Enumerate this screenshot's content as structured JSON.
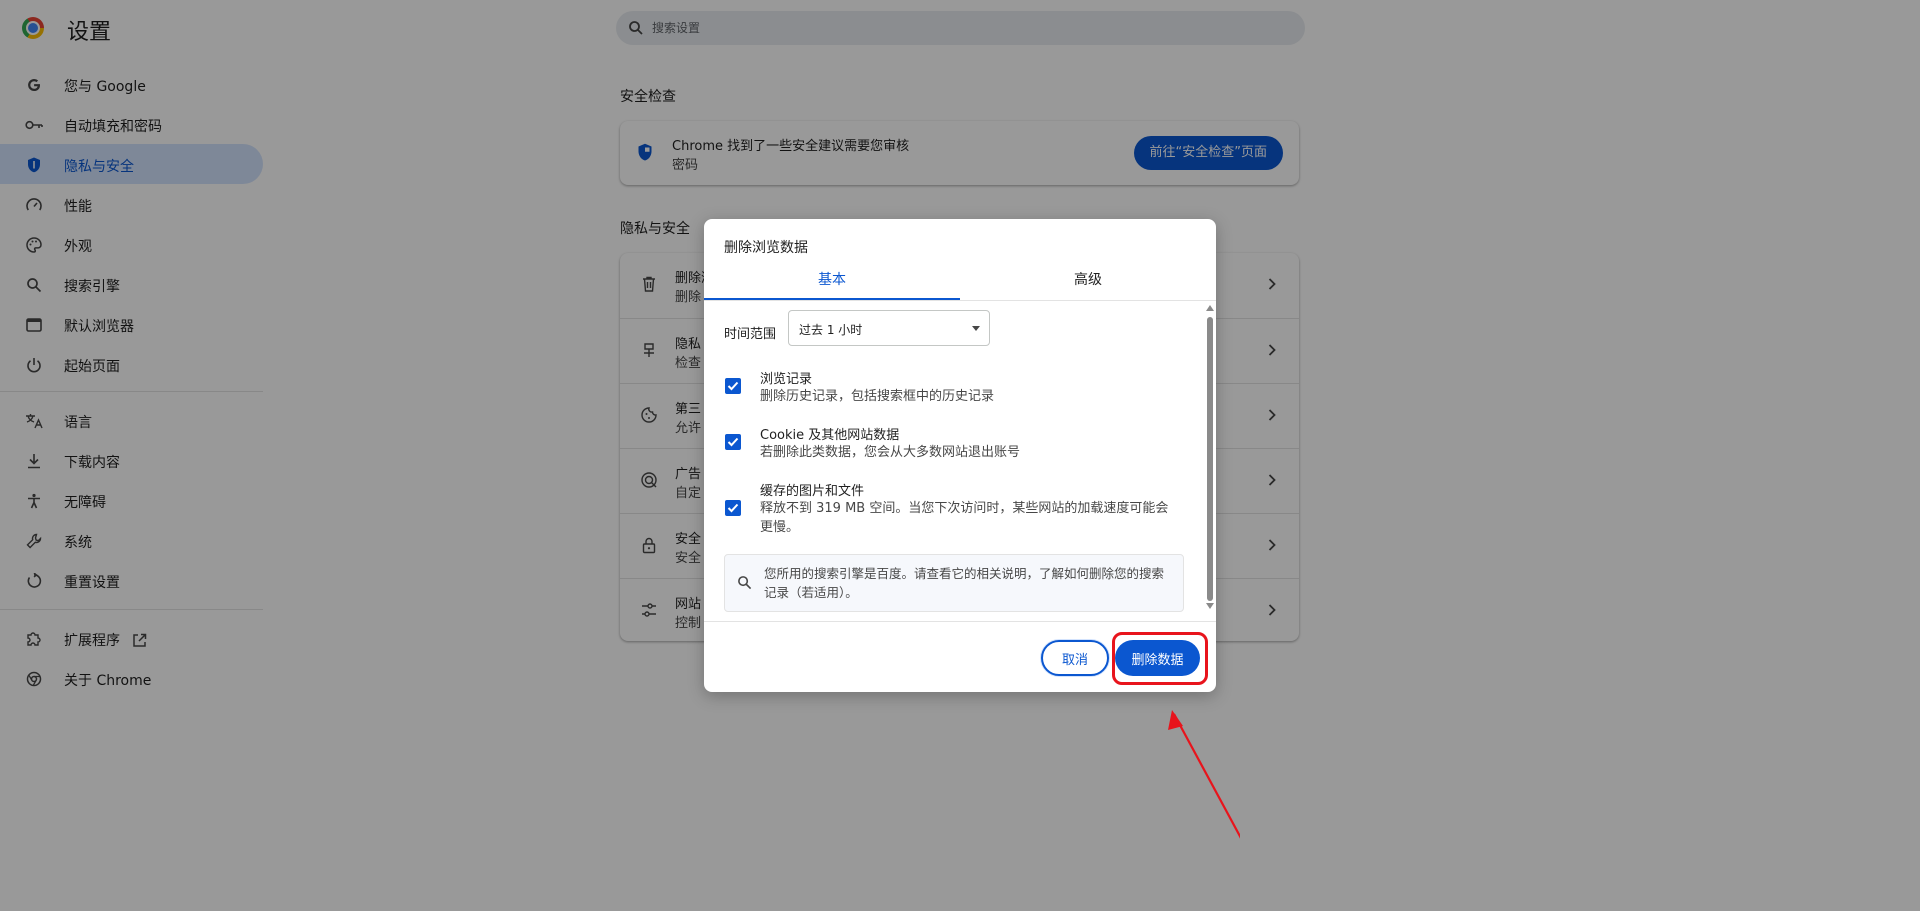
{
  "header": {
    "title": "设置",
    "search_placeholder": "搜索设置"
  },
  "sidebar": {
    "items": [
      {
        "label": "您与 Google",
        "icon": "google-g-icon"
      },
      {
        "label": "自动填充和密码",
        "icon": "key-icon"
      },
      {
        "label": "隐私与安全",
        "icon": "shield-icon",
        "active": true
      },
      {
        "label": "性能",
        "icon": "speedometer-icon"
      },
      {
        "label": "外观",
        "icon": "palette-icon"
      },
      {
        "label": "搜索引擎",
        "icon": "search-icon"
      },
      {
        "label": "默认浏览器",
        "icon": "browser-window-icon"
      },
      {
        "label": "起始页面",
        "icon": "power-icon"
      },
      {
        "label": "语言",
        "icon": "translate-icon"
      },
      {
        "label": "下载内容",
        "icon": "download-icon"
      },
      {
        "label": "无障碍",
        "icon": "accessibility-icon"
      },
      {
        "label": "系统",
        "icon": "wrench-icon"
      },
      {
        "label": "重置设置",
        "icon": "reset-icon"
      },
      {
        "label": "扩展程序",
        "icon": "puzzle-icon"
      },
      {
        "label": "关于 Chrome",
        "icon": "chrome-icon"
      }
    ]
  },
  "safety_check": {
    "section_title": "安全检查",
    "line1": "Chrome 找到了一些安全建议需要您审核",
    "line2": "密码",
    "button_label": "前往“安全检查”页面"
  },
  "privacy": {
    "section_title": "隐私与安全",
    "rows": [
      {
        "title": "删除浏",
        "desc": "删除",
        "icon": "trash-icon"
      },
      {
        "title": "隐私",
        "desc": "检查",
        "icon": "privacy-guide-icon"
      },
      {
        "title": "第三",
        "desc": "允许",
        "icon": "cookie-icon"
      },
      {
        "title": "广告",
        "desc": "自定",
        "icon": "ad-privacy-icon"
      },
      {
        "title": "安全",
        "desc": "安全",
        "icon": "lock-icon"
      },
      {
        "title": "网站",
        "desc": "控制",
        "icon": "tune-icon"
      }
    ]
  },
  "dialog": {
    "title": "删除浏览数据",
    "tabs": [
      "基本",
      "高级"
    ],
    "time_range_label": "时间范围",
    "time_range_value": "过去 1 小时",
    "options": [
      {
        "title": "浏览记录",
        "desc": "删除历史记录，包括搜索框中的历史记录",
        "checked": true
      },
      {
        "title": "Cookie 及其他网站数据",
        "desc": "若删除此类数据，您会从大多数网站退出账号",
        "checked": true
      },
      {
        "title": "缓存的图片和文件",
        "desc": "释放不到 319 MB 空间。当您下次访问时，某些网站的加载速度可能会更慢。",
        "checked": true
      }
    ],
    "info_text": "您所用的搜索引擎是百度。请查看它的相关说明，了解如何删除您的搜索记录（若适用）。",
    "cancel_label": "取消",
    "delete_label": "删除数据"
  },
  "colors": {
    "accent": "#0b57d0",
    "active_nav_bg": "#d3e3fd",
    "annotation_red": "#e8141c"
  }
}
